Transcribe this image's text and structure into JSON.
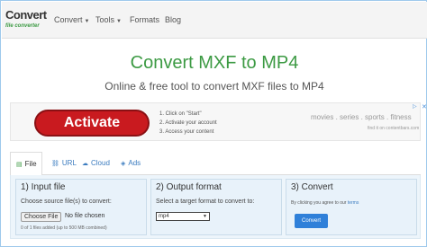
{
  "logo": {
    "main": "Convert",
    "sub": "file converter"
  },
  "nav": {
    "items": [
      {
        "label": "Convert",
        "dropdown": true
      },
      {
        "label": "Tools",
        "dropdown": true
      },
      {
        "label": "Formats",
        "dropdown": false
      },
      {
        "label": "Blog",
        "dropdown": false
      }
    ]
  },
  "hero": {
    "title": "Convert MXF to MP4",
    "subtitle": "Online & free tool to convert MXF files to MP4"
  },
  "ad": {
    "button": "Activate",
    "steps": [
      "1. Click on \"Start\"",
      "2. Activate your account",
      "3. Access your content"
    ],
    "tags": "movies . series . sports . fitness",
    "from": "find it on contentbars.com"
  },
  "tabs": [
    {
      "label": "File",
      "icon": "file-icon"
    },
    {
      "label": "URL",
      "icon": "link-icon"
    },
    {
      "label": "Cloud",
      "icon": "cloud-icon"
    },
    {
      "label": "Ads",
      "icon": "ads-icon"
    }
  ],
  "steps": {
    "input": {
      "title": "1) Input file",
      "text": "Choose source file(s) to convert:",
      "choose_button": "Choose File",
      "no_file": "No file chosen",
      "files_count": "0",
      "files_total": "1",
      "files_added_prefix": "of",
      "files_added_suffix": "files added (up to 500 MB combined)"
    },
    "output": {
      "title": "2) Output format",
      "text": "Select a target format to convert to:",
      "selected": "mp4"
    },
    "convert": {
      "title": "3) Convert",
      "agree_prefix": "By clicking you agree to our",
      "terms": "terms",
      "button": "Convert"
    }
  },
  "colors": {
    "brand_green": "#3c9a43",
    "ad_red": "#c91a1f",
    "link_blue": "#3a7bbf",
    "convert_blue": "#2f80d9",
    "panel_bg": "#edf5fb"
  }
}
